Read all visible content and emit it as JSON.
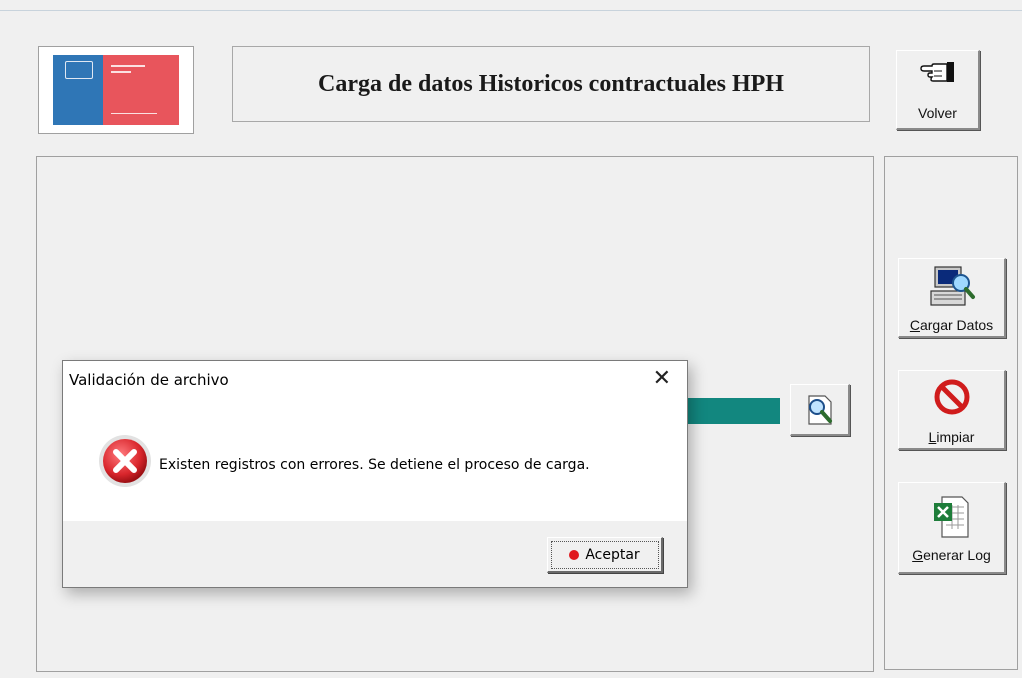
{
  "header": {
    "title": "Carga de datos Historicos contractuales HPH"
  },
  "buttons": {
    "volver": "Volver",
    "cargar_datos_accel": "C",
    "cargar_datos_rest": "argar Datos",
    "limpiar_accel": "L",
    "limpiar_rest": "impiar",
    "generar_log_accel": "G",
    "generar_log_rest": "enerar Log"
  },
  "dialog": {
    "title": "Validación de archivo",
    "close_glyph": "✕",
    "message": "Existen registros con errores. Se detiene el proceso de carga.",
    "ok_label": "Aceptar"
  },
  "colors": {
    "progress_fill": "#12877f",
    "logo_blue": "#2f76b6",
    "logo_red": "#e8555c",
    "error_icon": "#d9262c"
  },
  "icons": {
    "volver": "pointing-hand-icon",
    "cargar_datos": "computer-magnifier-icon",
    "limpiar": "no-entry-icon",
    "generar_log": "excel-document-icon",
    "browse": "document-magnifier-icon",
    "dialog_error": "error-x-icon"
  }
}
